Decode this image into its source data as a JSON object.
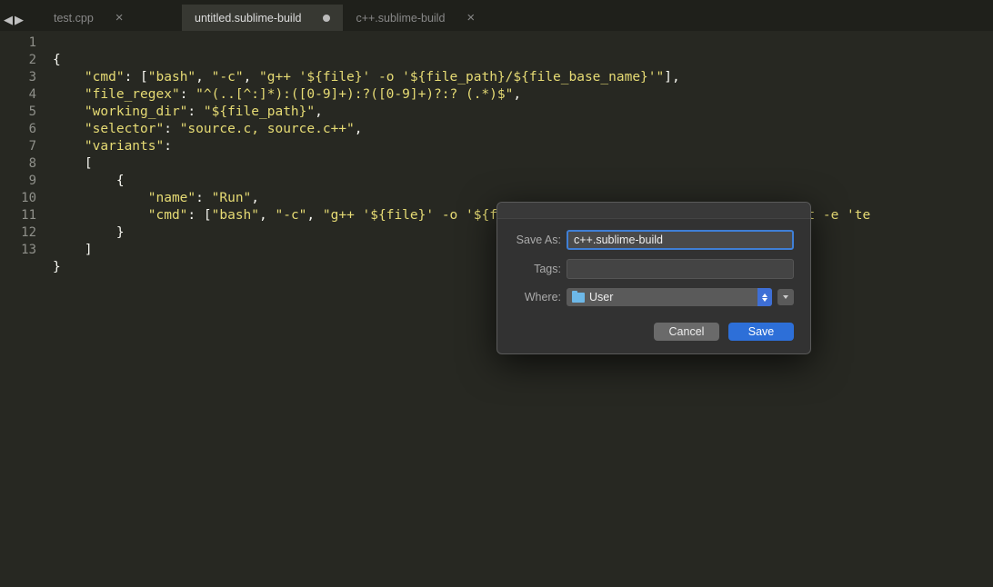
{
  "nav": {
    "back": "◀",
    "forward": "▶"
  },
  "tabs": [
    {
      "label": "test.cpp",
      "active": false,
      "dirty": false
    },
    {
      "label": "untitled.sublime-build",
      "active": true,
      "dirty": true
    },
    {
      "label": "c++.sublime-build",
      "active": false,
      "dirty": false
    }
  ],
  "lines": [
    "1",
    "2",
    "3",
    "4",
    "5",
    "6",
    "7",
    "8",
    "9",
    "10",
    "11",
    "12",
    "13"
  ],
  "code": {
    "l1": "{",
    "l2a": "    ",
    "l2b": "\"cmd\"",
    "l2c": ": [",
    "l2d": "\"bash\"",
    "l2e": ", ",
    "l2f": "\"-c\"",
    "l2g": ", ",
    "l2h": "\"g++ '${file}' -o '${file_path}/${file_base_name}'\"",
    "l2i": "],",
    "l3a": "    ",
    "l3b": "\"file_regex\"",
    "l3c": ": ",
    "l3d": "\"^(..[^:]*):([0-9]+):?([0-9]+)?:? (.*)$\"",
    "l3e": ",",
    "l4a": "    ",
    "l4b": "\"working_dir\"",
    "l4c": ": ",
    "l4d": "\"${file_path}\"",
    "l4e": ",",
    "l5a": "    ",
    "l5b": "\"selector\"",
    "l5c": ": ",
    "l5d": "\"source.c, source.c++\"",
    "l5e": ",",
    "l6a": "    ",
    "l6b": "\"variants\"",
    "l6c": ":",
    "l7": "    [",
    "l8": "        {",
    "l9a": "            ",
    "l9b": "\"name\"",
    "l9c": ": ",
    "l9d": "\"Run\"",
    "l9e": ",",
    "l10a": "            ",
    "l10b": "\"cmd\"",
    "l10c": ": [",
    "l10d": "\"bash\"",
    "l10e": ", ",
    "l10f": "\"-c\"",
    "l10g": ", ",
    "l10h": "\"g++ '${file}' -o '${file_path}/${file_base_name}'&& osascript -e 'te",
    "l11": "        }",
    "l12": "    ]",
    "l13": "}"
  },
  "dialog": {
    "saveAsLabel": "Save As:",
    "saveAsValue": "c++.sublime-build",
    "tagsLabel": "Tags:",
    "tagsValue": "",
    "whereLabel": "Where:",
    "whereValue": "User",
    "cancel": "Cancel",
    "save": "Save"
  }
}
